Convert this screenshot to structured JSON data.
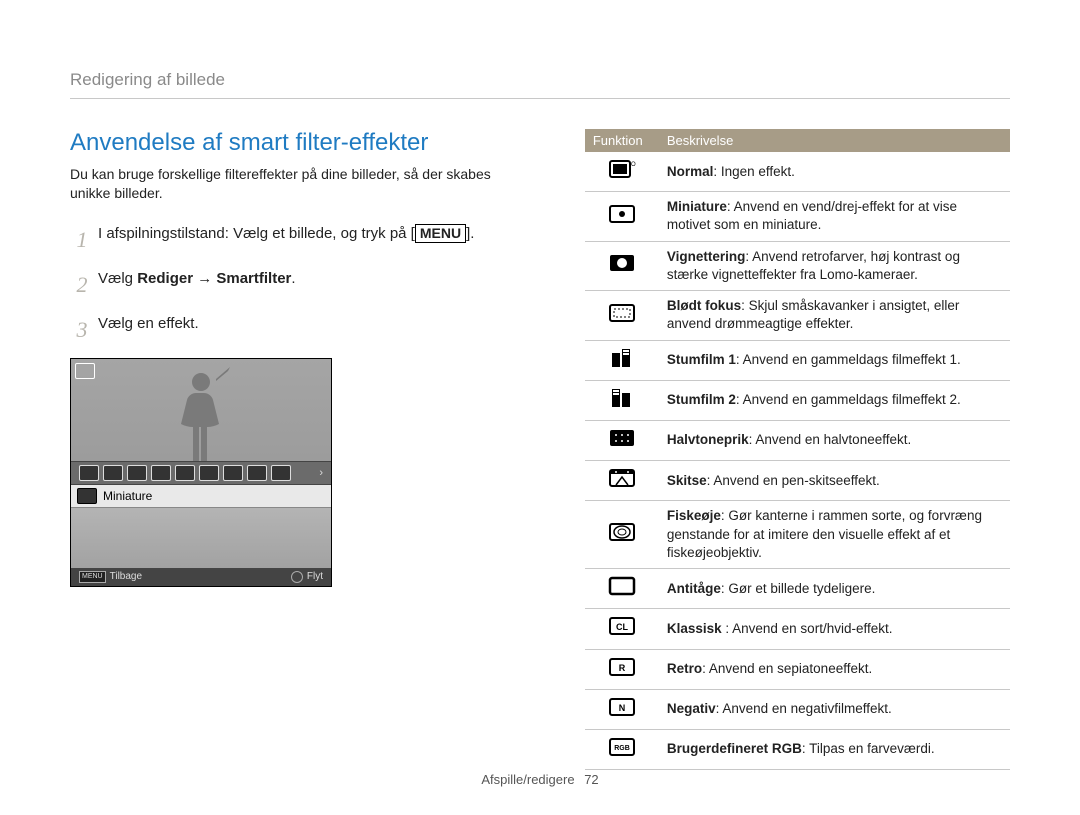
{
  "header": {
    "running_title": "Redigering af billede"
  },
  "section": {
    "title": "Anvendelse af smart filter-effekter",
    "intro": "Du kan bruge forskellige filtereffekter på dine billeder, så der skabes unikke billeder.",
    "menu_key": "MENU"
  },
  "steps": [
    {
      "num": "1",
      "prefix": "I afspilningstilstand: Vælg et billede, og tryk på [",
      "suffix": "]."
    },
    {
      "num": "2",
      "text_pre": "Vælg ",
      "text_bold": "Rediger → Smartfilter",
      "text_post": "."
    },
    {
      "num": "3",
      "text": "Vælg en effekt."
    }
  ],
  "camera_ui": {
    "selected_label": "Miniature",
    "back_key": "MENU",
    "back_label": "Tilbage",
    "move_label": "Flyt"
  },
  "table": {
    "head_fn": "Funktion",
    "head_desc": "Beskrivelse",
    "rows": [
      {
        "icon": "off",
        "name": "Normal",
        "desc": ": Ingen effekt."
      },
      {
        "icon": "miniature",
        "name": "Miniature",
        "desc": ": Anvend en vend/drej-effekt for at vise motivet som en miniature."
      },
      {
        "icon": "vignette",
        "name": "Vignettering",
        "desc": ": Anvend retrofarver, høj kontrast og stærke vignetteffekter fra Lomo-kameraer."
      },
      {
        "icon": "softfocus",
        "name": "Blødt fokus",
        "desc": ": Skjul småskavanker i ansigtet, eller anvend drømmeagtige effekter."
      },
      {
        "icon": "oldfilm1",
        "name": "Stumfilm 1",
        "desc": ": Anvend en gammeldags filmeffekt 1."
      },
      {
        "icon": "oldfilm2",
        "name": "Stumfilm 2",
        "desc": ": Anvend en gammeldags filmeffekt 2."
      },
      {
        "icon": "halftone",
        "name": "Halvtoneprik",
        "desc": ": Anvend en halvtoneeffekt."
      },
      {
        "icon": "sketch",
        "name": "Skitse",
        "desc": ": Anvend en pen-skitseeffekt."
      },
      {
        "icon": "fisheye",
        "name": "Fiskeøje",
        "desc": ": Gør kanterne i rammen sorte, og forvræng genstande for at imitere den visuelle effekt af et fiskeøjeobjektiv."
      },
      {
        "icon": "defog",
        "name": "Antitåge",
        "desc": ": Gør et billede tydeligere."
      },
      {
        "icon": "classic",
        "name": "Klassisk ",
        "desc": ": Anvend en sort/hvid-effekt."
      },
      {
        "icon": "retro",
        "name": "Retro",
        "desc": ": Anvend en sepiatoneeffekt."
      },
      {
        "icon": "negative",
        "name": "Negativ",
        "desc": ": Anvend en negativfilmeffekt."
      },
      {
        "icon": "rgb",
        "name": "Brugerdefineret RGB",
        "desc": ": Tilpas en farveværdi."
      }
    ]
  },
  "footer": {
    "section": "Afspille/redigere",
    "page": "72"
  }
}
